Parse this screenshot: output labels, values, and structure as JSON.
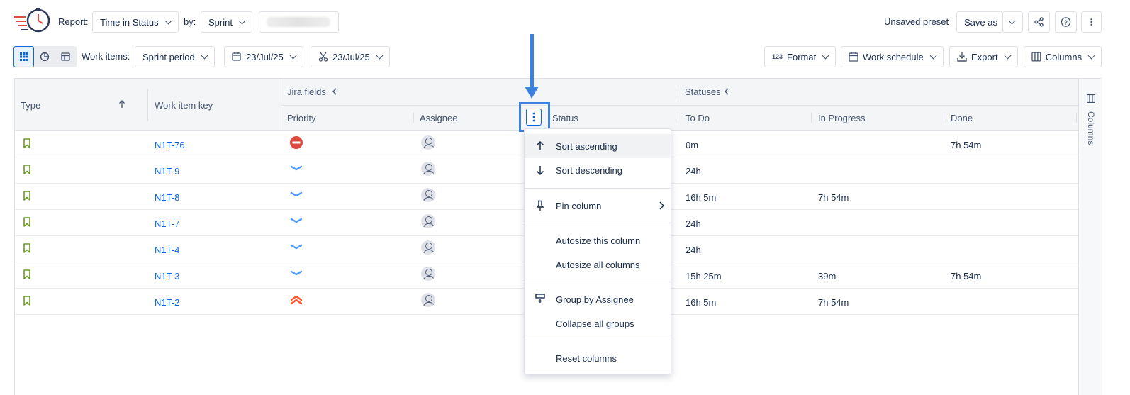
{
  "toolbar": {
    "report_label": "Report:",
    "report_value": "Time in Status",
    "by_label": "by:",
    "by_value": "Sprint",
    "unsaved_preset": "Unsaved preset",
    "save_as": "Save as",
    "work_items_label": "Work items:",
    "period_value": "Sprint period",
    "start_date": "23/Jul/25",
    "end_date": "23/Jul/25",
    "format_label": "Format",
    "format_icon_text": "123",
    "work_schedule_label": "Work schedule",
    "export_label": "Export",
    "columns_label": "Columns"
  },
  "table": {
    "group_headers": {
      "jira_fields": "Jira fields",
      "statuses": "Statuses"
    },
    "columns": {
      "type": "Type",
      "key": "Work item key",
      "priority": "Priority",
      "assignee": "Assignee",
      "status": "Status",
      "todo": "To Do",
      "inprogress": "In Progress",
      "done": "Done"
    },
    "rows": [
      {
        "key": "N1T-76",
        "priority": "blocker",
        "todo": "0m",
        "inprogress": "",
        "done": "7h 54m"
      },
      {
        "key": "N1T-9",
        "priority": "low",
        "todo": "24h",
        "inprogress": "",
        "done": ""
      },
      {
        "key": "N1T-8",
        "priority": "low",
        "todo": "16h 5m",
        "inprogress": "7h 54m",
        "done": ""
      },
      {
        "key": "N1T-7",
        "priority": "low",
        "todo": "24h",
        "inprogress": "",
        "done": ""
      },
      {
        "key": "N1T-4",
        "priority": "low",
        "todo": "24h",
        "inprogress": "",
        "done": ""
      },
      {
        "key": "N1T-3",
        "priority": "low",
        "todo": "15h 25m",
        "inprogress": "39m",
        "done": "7h 54m"
      },
      {
        "key": "N1T-2",
        "priority": "highest",
        "todo": "16h 5m",
        "inprogress": "7h 54m",
        "done": ""
      }
    ],
    "side_panel_label": "Columns"
  },
  "menu": {
    "sort_asc": "Sort ascending",
    "sort_desc": "Sort descending",
    "pin": "Pin column",
    "autosize_this": "Autosize this column",
    "autosize_all": "Autosize all columns",
    "group_by": "Group by Assignee",
    "collapse": "Collapse all groups",
    "reset": "Reset columns"
  },
  "colors": {
    "accent_blue": "#0c66e4",
    "annotation_blue": "#3b82e0",
    "story_green": "#6a9a23",
    "blocker_red": "#e2483d",
    "low_blue": "#4c9aff",
    "highest_orange": "#ff5630"
  },
  "icons": [
    "logo-stopwatch-icon",
    "chevron-down-icon",
    "share-icon",
    "help-icon",
    "more-vertical-icon",
    "grid-view-icon",
    "pie-chart-icon",
    "calendar-view-icon",
    "calendar-start-icon",
    "calendar-cut-icon",
    "format-icon",
    "calendar-icon",
    "export-icon",
    "columns-icon",
    "sort-arrow-up-icon",
    "collapse-left-icon",
    "bookmark-icon",
    "avatar-icon",
    "arrow-up-icon",
    "arrow-down-icon",
    "pin-icon",
    "chevron-right-icon",
    "group-icon"
  ]
}
